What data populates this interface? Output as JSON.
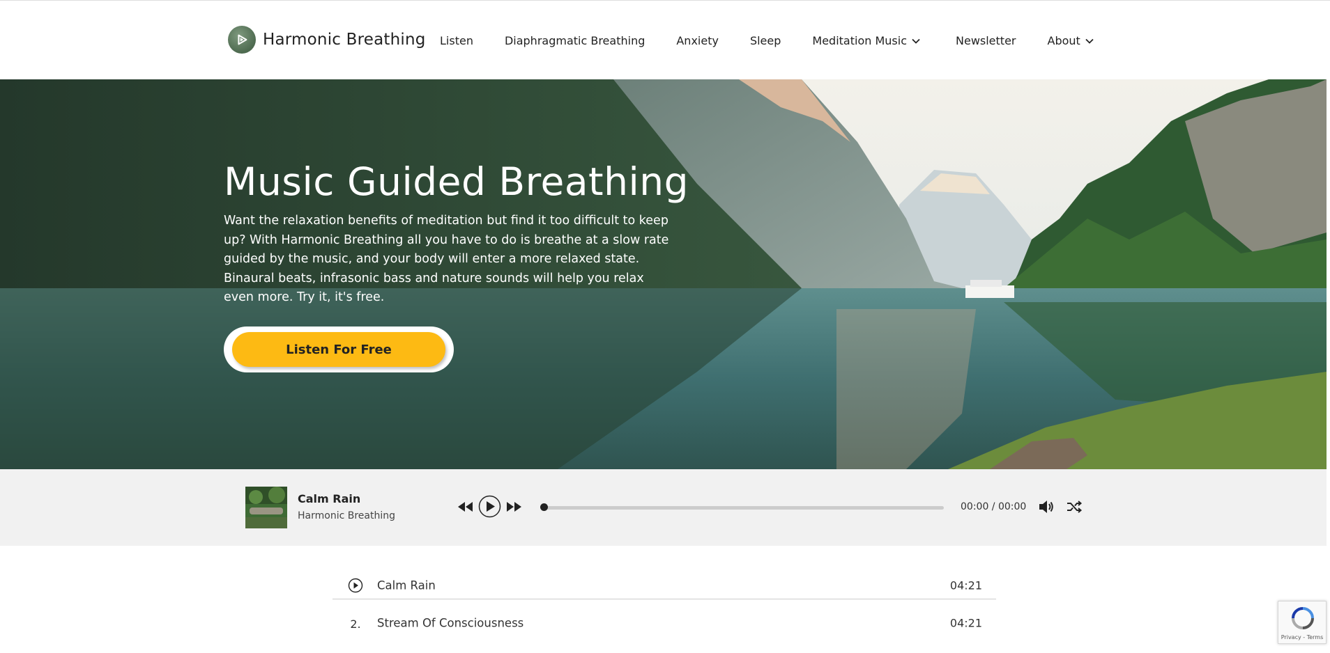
{
  "brand": {
    "name": "Harmonic Breathing",
    "logo_icon": "play-logo-icon",
    "accent": "#fdba13",
    "logo_color": "#5a775c"
  },
  "nav": {
    "items": [
      {
        "label": "Listen"
      },
      {
        "label": "Diaphragmatic Breathing"
      },
      {
        "label": "Anxiety"
      },
      {
        "label": "Sleep"
      },
      {
        "label": "Meditation Music",
        "icon": "chevron-down-icon"
      },
      {
        "label": "Newsletter"
      },
      {
        "label": "About",
        "icon": "chevron-down-icon"
      }
    ]
  },
  "hero": {
    "title": "Music Guided Breathing",
    "description": "Want the relaxation benefits of meditation but find it too difficult to keep up? With Harmonic Breathing all you have to do is breathe at a slow rate guided by the music, and your body will enter a more relaxed state. Binaural beats, infrasonic bass and nature sounds will help you relax even more.  Try it, it's free.",
    "cta_label": "Listen For Free"
  },
  "player": {
    "track_title": "Calm Rain",
    "track_artist": "Harmonic Breathing",
    "current_time": "00:00",
    "total_time": "00:00",
    "time_separator": " / ",
    "progress": 0,
    "controls": [
      "rewind-icon",
      "play-icon",
      "fast-forward-icon",
      "volume-icon",
      "shuffle-icon"
    ]
  },
  "playlist": [
    {
      "index": "",
      "icon": "play-circle-icon",
      "title": "Calm Rain",
      "duration": "04:21"
    },
    {
      "index": "2.",
      "title": "Stream Of Consciousness",
      "duration": "04:21"
    }
  ],
  "recaptcha": {
    "terms": "Privacy - Terms"
  }
}
